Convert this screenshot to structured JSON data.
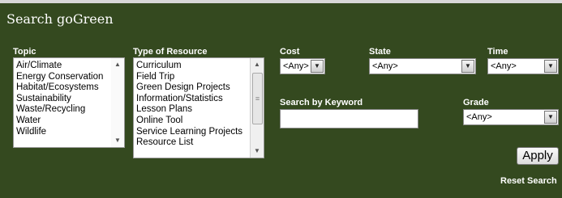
{
  "title": "Search goGreen",
  "topic": {
    "label": "Topic",
    "items": [
      "Air/Climate",
      "Energy Conservation",
      "Habitat/Ecosystems",
      "Sustainability",
      "Waste/Recycling",
      "Water",
      "Wildlife"
    ]
  },
  "resource": {
    "label": "Type of Resource",
    "items": [
      "Curriculum",
      "Field Trip",
      "Green Design Projects",
      "Information/Statistics",
      "Lesson Plans",
      "Online Tool",
      "Service Learning Projects",
      "Resource List"
    ]
  },
  "cost": {
    "label": "Cost",
    "value": "<Any>"
  },
  "state": {
    "label": "State",
    "value": "<Any>"
  },
  "time": {
    "label": "Time",
    "value": "<Any>"
  },
  "grade": {
    "label": "Grade",
    "value": "<Any>"
  },
  "keyword": {
    "label": "Search by Keyword",
    "value": ""
  },
  "apply_label": "Apply",
  "reset_label": "Reset Search",
  "icons": {
    "dropdown": "chevron-down-icon",
    "scroll_up": "scroll-up-arrow-icon",
    "scroll_down": "scroll-down-arrow-icon",
    "scroll_grip": "scroll-grip-icon"
  },
  "colors": {
    "panel_background": "#34491f",
    "text": "#ffffff"
  }
}
